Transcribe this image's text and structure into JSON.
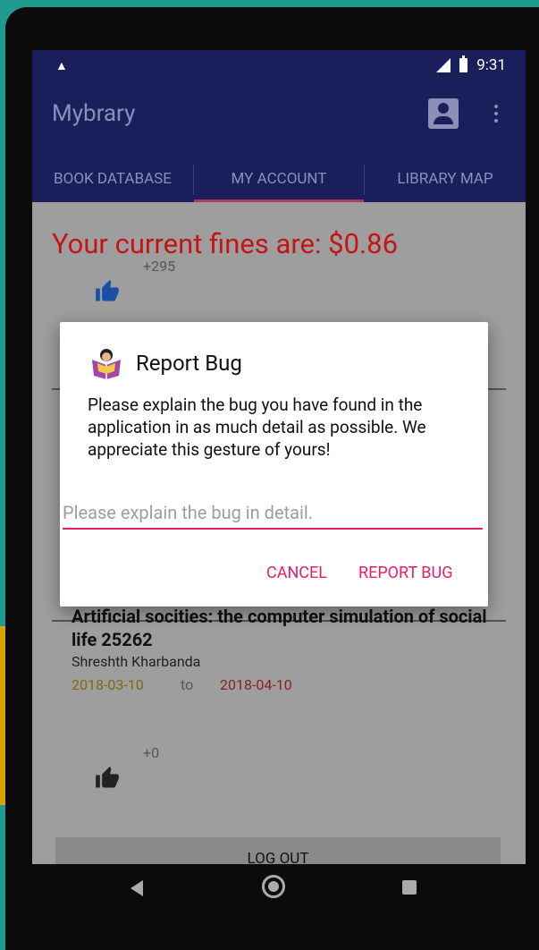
{
  "status_bar": {
    "time": "9:31",
    "network": "LTE"
  },
  "app": {
    "title": "Mybrary"
  },
  "tabs": [
    {
      "label": "BOOK DATABASE",
      "active": false
    },
    {
      "label": "MY ACCOUNT",
      "active": true
    },
    {
      "label": "LIBRARY MAP",
      "active": false
    }
  ],
  "account": {
    "fines_text": "Your current fines are: $0.86",
    "items": [
      {
        "likes": "+295"
      },
      {
        "title": "Artificial socities: the computer simulation of social life 25262",
        "author": "Shreshth Kharbanda",
        "issue_date": "2018-03-10",
        "to_label": "to",
        "due_date": "2018-04-10",
        "likes": "+0"
      }
    ],
    "logout_label": "LOG OUT"
  },
  "dialog": {
    "title": "Report Bug",
    "message": "Please explain the bug you have found in the application in as much detail as possible. We appreciate this gesture of yours!",
    "input_placeholder": "Please explain the bug in detail.",
    "input_value": "",
    "cancel_label": "CANCEL",
    "confirm_label": "REPORT BUG"
  },
  "colors": {
    "primary": "#1a1f5c",
    "accent": "#e91e63",
    "fines": "#c41414"
  }
}
